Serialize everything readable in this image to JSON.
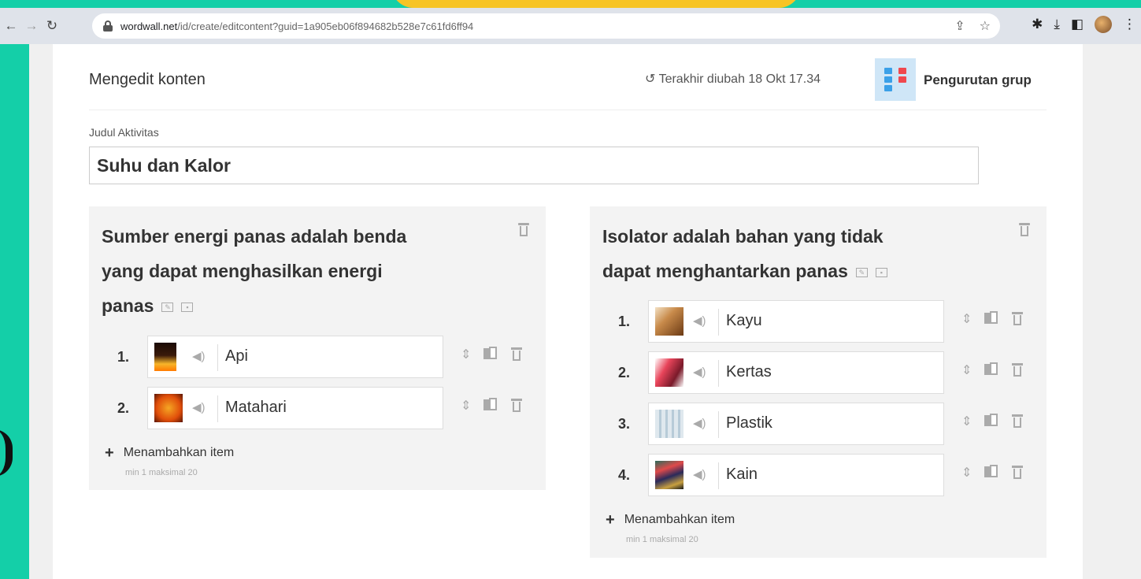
{
  "browser": {
    "url_domain": "wordwall.net",
    "url_path": "/id/create/editcontent?guid=1a905eb06f894682b528e7c61fd6ff94"
  },
  "header": {
    "title": "Mengedit konten",
    "last_edited": "Terakhir diubah 18 Okt 17.34",
    "template_name": "Pengurutan grup"
  },
  "activity": {
    "label": "Judul Aktivitas",
    "value": "Suhu dan Kalor"
  },
  "groups": [
    {
      "title_lines": [
        "Sumber energi panas adalah benda",
        "yang dapat menghasilkan energi",
        "panas"
      ],
      "items": [
        {
          "num": "1.",
          "text": "Api",
          "thumb": "fire-image"
        },
        {
          "num": "2.",
          "text": "Matahari",
          "thumb": "sun-image"
        }
      ],
      "add_label": "Menambahkan item",
      "limits": "min 1   maksimal 20"
    },
    {
      "title_lines": [
        "Isolator adalah bahan yang tidak",
        "dapat menghantarkan panas"
      ],
      "items": [
        {
          "num": "1.",
          "text": "Kayu",
          "thumb": "wood-image"
        },
        {
          "num": "2.",
          "text": "Kertas",
          "thumb": "paper-image"
        },
        {
          "num": "3.",
          "text": "Plastik",
          "thumb": "plastic-image"
        },
        {
          "num": "4.",
          "text": "Kain",
          "thumb": "cloth-image"
        }
      ],
      "add_label": "Menambahkan item",
      "limits": "min 1   maksimal 20"
    }
  ]
}
